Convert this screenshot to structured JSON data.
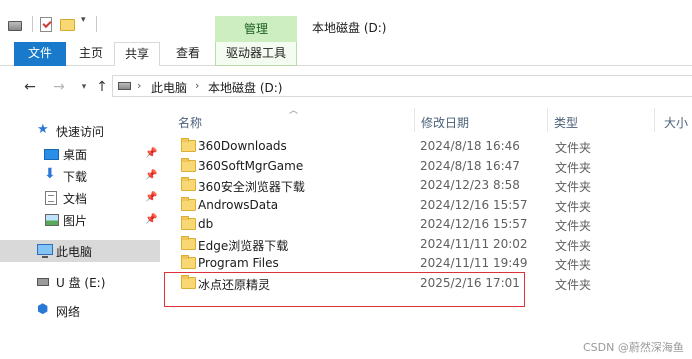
{
  "window": {
    "title": "本地磁盘 (D:)",
    "contextual_group": "管理"
  },
  "ribbon": {
    "tabs": [
      "文件",
      "主页",
      "共享",
      "查看",
      "驱动器工具"
    ]
  },
  "address": {
    "breadcrumbs": [
      "此电脑",
      "本地磁盘 (D:)"
    ]
  },
  "sidebar": {
    "items": [
      {
        "label": "快速访问",
        "icon": "star-icon"
      },
      {
        "label": "桌面",
        "icon": "desktop-icon",
        "pinned": true
      },
      {
        "label": "下载",
        "icon": "download-icon",
        "pinned": true
      },
      {
        "label": "文档",
        "icon": "document-icon",
        "pinned": true
      },
      {
        "label": "图片",
        "icon": "pictures-icon",
        "pinned": true
      },
      {
        "label": "此电脑",
        "icon": "this-pc-icon",
        "selected": true
      },
      {
        "label": "U 盘 (E:)",
        "icon": "usb-drive-icon"
      },
      {
        "label": "网络",
        "icon": "network-icon"
      }
    ]
  },
  "columns": {
    "name": "名称",
    "modified": "修改日期",
    "type": "类型",
    "size": "大小"
  },
  "files": [
    {
      "name": "360Downloads",
      "modified": "2024/8/18 16:46",
      "type": "文件夹"
    },
    {
      "name": "360SoftMgrGame",
      "modified": "2024/8/18 16:47",
      "type": "文件夹"
    },
    {
      "name": "360安全浏览器下载",
      "modified": "2024/12/23 8:58",
      "type": "文件夹"
    },
    {
      "name": "AndrowsData",
      "modified": "2024/12/16 15:57",
      "type": "文件夹"
    },
    {
      "name": "db",
      "modified": "2024/12/16 15:57",
      "type": "文件夹"
    },
    {
      "name": "Edge浏览器下载",
      "modified": "2024/11/11 20:02",
      "type": "文件夹"
    },
    {
      "name": "Program Files",
      "modified": "2024/11/11 19:49",
      "type": "文件夹"
    },
    {
      "name": "冰点还原精灵",
      "modified": "2025/2/16 17:01",
      "type": "文件夹"
    }
  ],
  "watermark": "CSDN @蔚然深海鱼",
  "colors": {
    "accent": "#1979ca",
    "context_tab": "#cdeec0",
    "highlight": "#e0303a"
  }
}
